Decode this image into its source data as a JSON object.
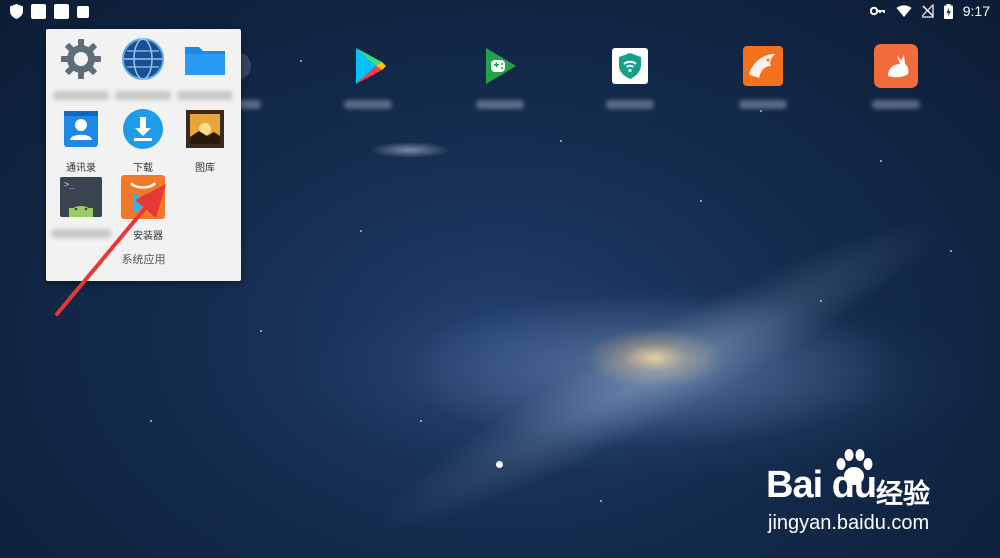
{
  "status_bar": {
    "time": "9:17",
    "left_icons": [
      "shield-icon",
      "notification-square-icon",
      "notification-square-icon",
      "notification-square-icon"
    ],
    "right_icons": [
      "vpn-key-icon",
      "wifi-icon",
      "no-signal-icon",
      "battery-charging-icon"
    ]
  },
  "folder": {
    "title": "系统应用",
    "items": [
      {
        "label": "",
        "icon": "settings-gear-icon"
      },
      {
        "label": "",
        "icon": "browser-globe-icon"
      },
      {
        "label": "",
        "icon": "file-manager-folder-icon"
      },
      {
        "label": "通讯录",
        "icon": "contacts-icon"
      },
      {
        "label": "下载",
        "icon": "download-icon"
      },
      {
        "label": "图库",
        "icon": "gallery-icon"
      },
      {
        "label": "",
        "icon": "android-terminal-icon"
      },
      {
        "label": "安装器",
        "icon": "app-installer-icon"
      }
    ]
  },
  "home_icons": [
    {
      "name": "google-play-store-icon",
      "label": ""
    },
    {
      "name": "google-play-games-icon",
      "label": ""
    },
    {
      "name": "wifi-security-shield-icon",
      "label": ""
    },
    {
      "name": "cheetah-browser-icon",
      "label": ""
    },
    {
      "name": "rabbit-app-icon",
      "label": ""
    }
  ],
  "watermark": {
    "brand": "Bai du",
    "cn": "经验",
    "url": "jingyan.baidu.com"
  },
  "colors": {
    "folder_bg": "#f2f2f2",
    "arrow": "#e53935",
    "wallpaper_dark": "#0c1c35"
  }
}
